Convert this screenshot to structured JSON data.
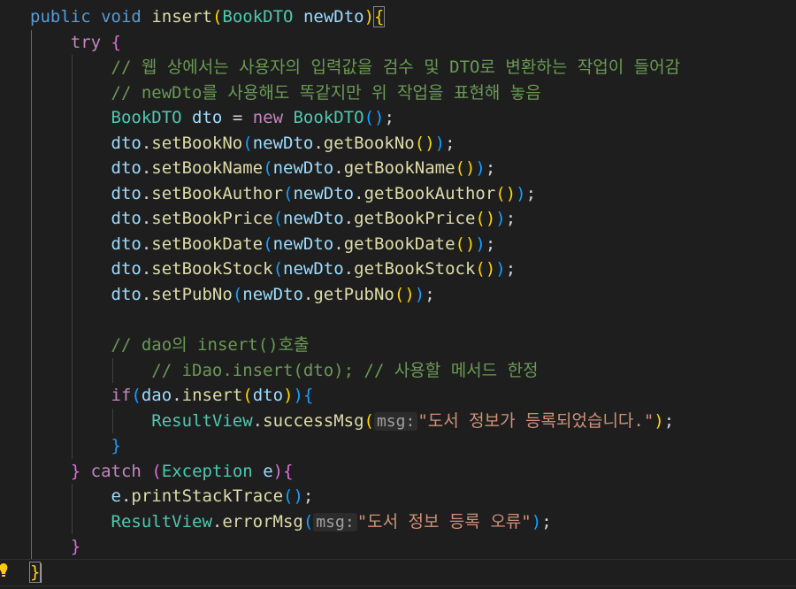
{
  "code": {
    "l1": {
      "kw1": "public",
      "kw2": "void",
      "fn": "insert",
      "p_open": "(",
      "type": "BookDTO",
      "param": "newDto",
      "p_close": ")",
      "brace": "{"
    },
    "l2": {
      "kw": "try",
      "brace": "{"
    },
    "l3": {
      "comment": "// 웹 상에서는 사용자의 입력값을 검수 및 DTO로 변환하는 작업이 들어감"
    },
    "l4": {
      "comment": "// newDto를 사용해도 똑같지만 위 작업을 표현해 놓음"
    },
    "l5": {
      "type1": "BookDTO",
      "var": "dto",
      "eq": " = ",
      "kw": "new",
      "type2": "BookDTO",
      "parens": "()",
      "semi": ";"
    },
    "setters": [
      {
        "setter": "setBookNo",
        "getter": "getBookNo"
      },
      {
        "setter": "setBookName",
        "getter": "getBookName"
      },
      {
        "setter": "setBookAuthor",
        "getter": "getBookAuthor"
      },
      {
        "setter": "setBookPrice",
        "getter": "getBookPrice"
      },
      {
        "setter": "setBookDate",
        "getter": "getBookDate"
      },
      {
        "setter": "setBookStock",
        "getter": "getBookStock"
      },
      {
        "setter": "setPubNo",
        "getter": "getPubNo"
      }
    ],
    "obj_dto": "dto",
    "obj_newdto": "newDto",
    "l14": {
      "comment": "// dao의 insert()호출"
    },
    "l15": {
      "comment": "// iDao.insert(dto); // 사용할 메서드 한정"
    },
    "l16": {
      "kw": "if",
      "obj": "dao",
      "fn": "insert",
      "arg": "dto",
      "brace": "{"
    },
    "l17": {
      "type": "ResultView",
      "fn": "successMsg",
      "hint": "msg:",
      "str": "\"도서 정보가 등록되었습니다.\"",
      "end": ");"
    },
    "l18": {
      "brace": "}"
    },
    "l19": {
      "close": "}",
      "kw": "catch",
      "type": "Exception",
      "param": "e",
      "brace": "{"
    },
    "l20": {
      "obj": "e",
      "fn": "printStackTrace",
      "end": "();"
    },
    "l21": {
      "type": "ResultView",
      "fn": "errorMsg",
      "hint": "msg:",
      "str": "\"도서 정보 등록 오류\"",
      "end": ");"
    },
    "l22": {
      "brace": "}"
    },
    "l23": {
      "brace": "}"
    }
  },
  "icons": {
    "gutter": "lightbulb-icon"
  },
  "colors": {
    "background": "#1e1e1e",
    "keyword": "#569cd6",
    "control": "#c586c0",
    "type": "#4ec9b0",
    "variable": "#9cdcfe",
    "function": "#dcdcaa",
    "string": "#ce9178",
    "comment": "#6a9955"
  }
}
